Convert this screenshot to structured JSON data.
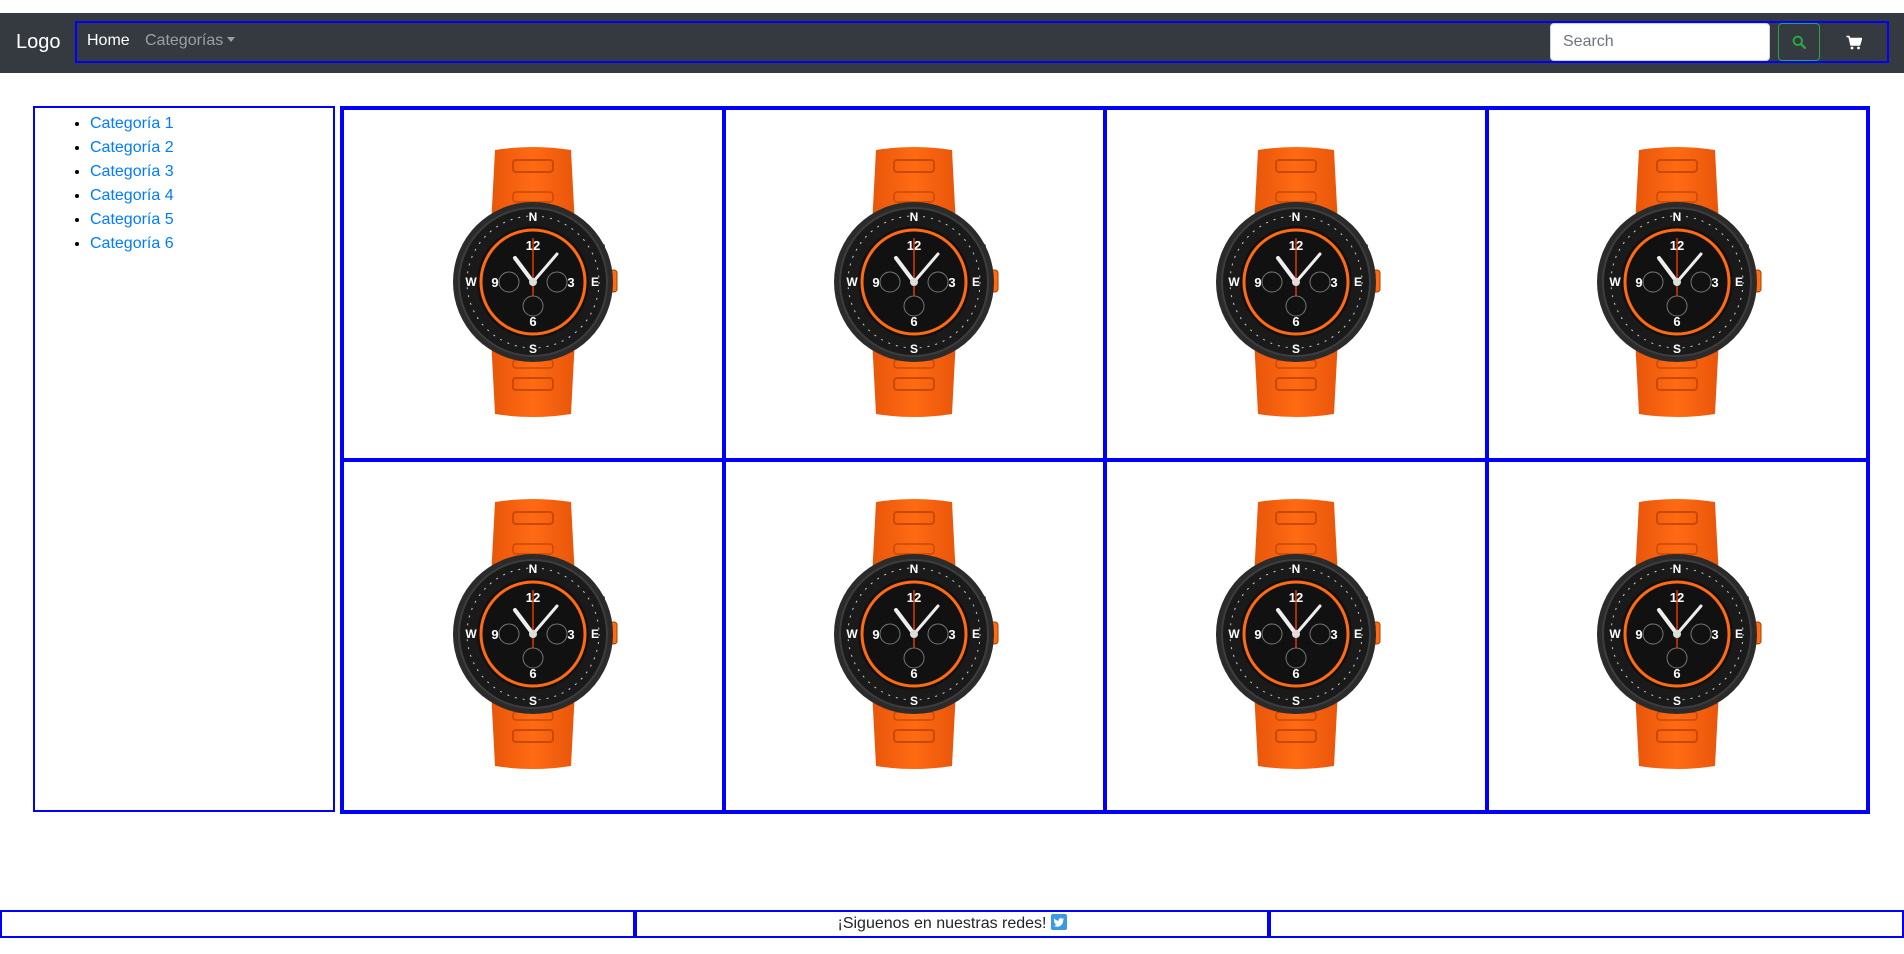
{
  "navbar": {
    "brand": "Logo",
    "home_label": "Home",
    "categories_label": "Categorías",
    "search_placeholder": "Search",
    "search_icon": "search-icon",
    "cart_icon": "cart-icon",
    "background_color": "#343a40",
    "search_button_color": "#28a745"
  },
  "sidebar": {
    "items": [
      {
        "label": "Categoría 1"
      },
      {
        "label": "Categoría 2"
      },
      {
        "label": "Categoría 3"
      },
      {
        "label": "Categoría 4"
      },
      {
        "label": "Categoría 5"
      },
      {
        "label": "Categoría 6"
      }
    ]
  },
  "products": {
    "rows": 2,
    "columns": 4,
    "image": "orange-strap-chronograph-watch",
    "count": 8
  },
  "footer": {
    "text": "¡Siguenos en nuestras redes!",
    "icon": "twitter-icon"
  },
  "colors": {
    "border": "#0000ff",
    "link": "#007bff",
    "strap": "#ff6a13"
  }
}
